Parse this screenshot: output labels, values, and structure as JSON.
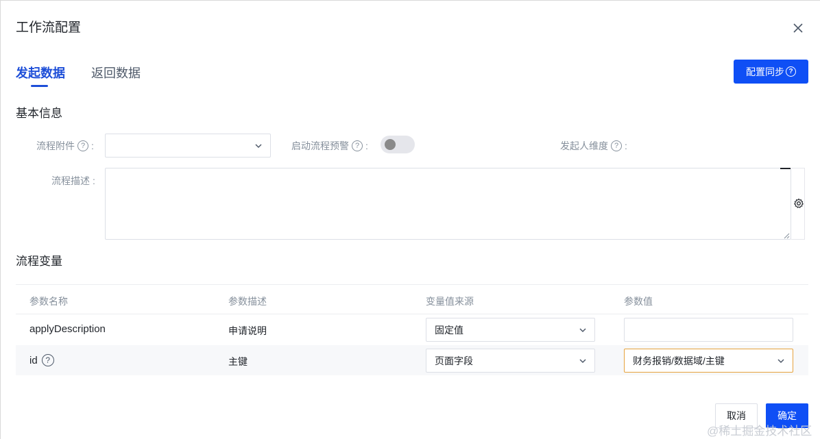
{
  "dialog": {
    "title": "工作流配置"
  },
  "tabs": [
    {
      "label": "发起数据",
      "active": true
    },
    {
      "label": "返回数据",
      "active": false
    }
  ],
  "sync_button": {
    "label": "配置同步",
    "icon": "question-circle-icon"
  },
  "basic_info": {
    "heading": "基本信息",
    "attachment_label": "流程附件",
    "attachment_value": "",
    "warning_label": "启动流程预警",
    "warning_enabled": false,
    "initiator_label": "发起人维度",
    "description_label": "流程描述",
    "description_value": "",
    "colon": ":"
  },
  "variables": {
    "heading": "流程变量",
    "columns": [
      "参数名称",
      "参数描述",
      "变量值来源",
      "参数值"
    ],
    "rows": [
      {
        "name": "applyDescription",
        "desc": "申请说明",
        "source": "固定值",
        "value": ""
      },
      {
        "name": "id",
        "desc": "主键",
        "source": "页面字段",
        "value": "财务报销/数据域/主键",
        "has_help": true
      }
    ]
  },
  "footer": {
    "cancel_label": "取消",
    "ok_label": "确定"
  },
  "watermark": "@稀土掘金技术社区",
  "colors": {
    "primary": "#0f4ff5",
    "tab_active": "#1d4ed8",
    "focus_border": "#e6a23c"
  }
}
